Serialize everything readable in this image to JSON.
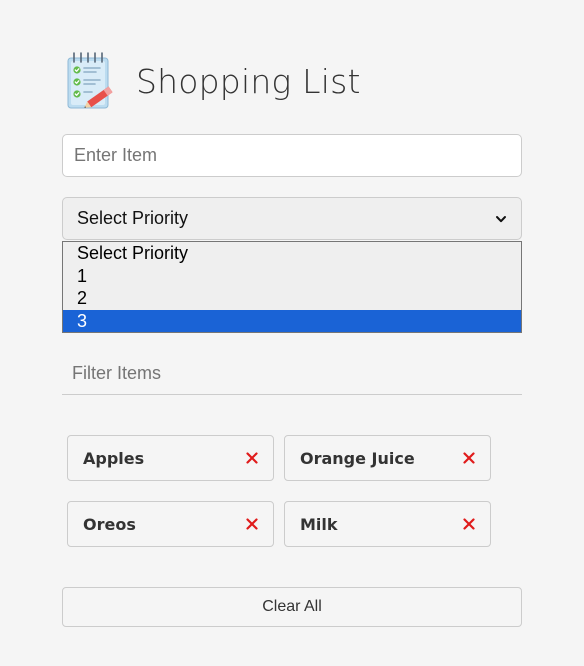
{
  "header": {
    "title": "Shopping List",
    "logo_icon": "notepad-checklist-icon"
  },
  "item_input": {
    "placeholder": "Enter Item",
    "value": ""
  },
  "priority": {
    "selected_label": "Select Priority",
    "options": [
      "Select Priority",
      "1",
      "2",
      "3"
    ],
    "highlighted_option": "3",
    "highlight_color": "#1a63d6"
  },
  "filter": {
    "placeholder": "Filter Items",
    "value": ""
  },
  "items": [
    {
      "name": "Apples"
    },
    {
      "name": "Orange Juice"
    },
    {
      "name": "Oreos"
    },
    {
      "name": "Milk"
    }
  ],
  "remove_icon_color": "#e01b1b",
  "clear_button": {
    "label": "Clear All"
  }
}
